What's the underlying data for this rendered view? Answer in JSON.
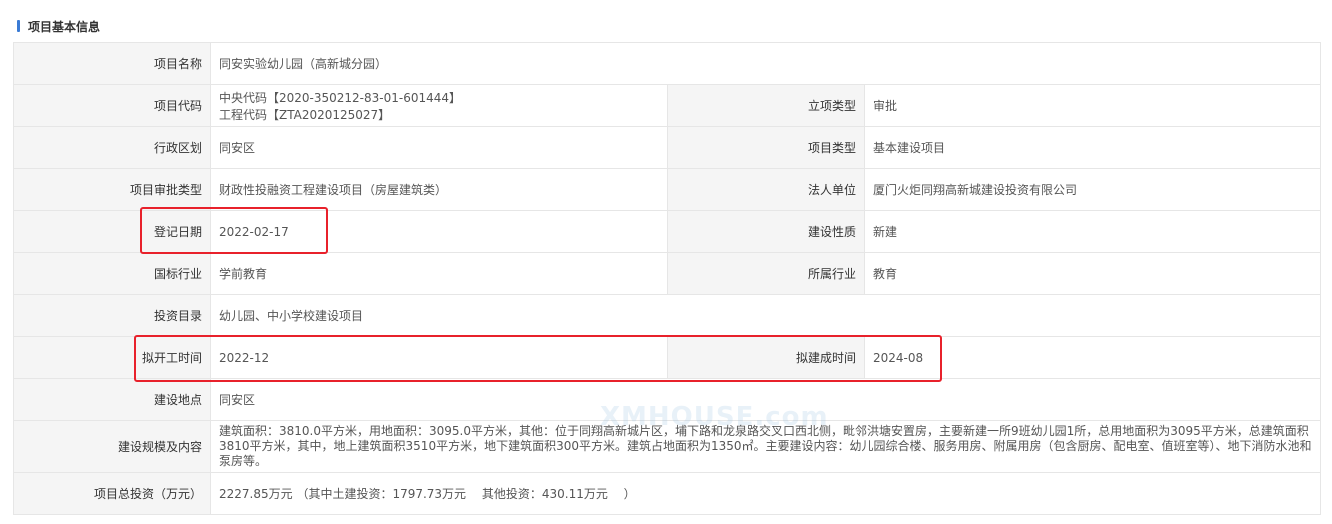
{
  "section": {
    "title": "项目基本信息"
  },
  "watermark": "XMHOUSE.com",
  "fields": {
    "project_name": {
      "label": "项目名称",
      "value": "同安实验幼儿园（高新城分园）"
    },
    "project_code": {
      "label": "项目代码",
      "value_line1": "中央代码【2020-350212-83-01-601444】",
      "value_line2": "工程代码【ZTA2020125027】"
    },
    "approval_type": {
      "label": "立项类型",
      "value": "审批"
    },
    "district": {
      "label": "行政区划",
      "value": "同安区"
    },
    "project_type": {
      "label": "项目类型",
      "value": "基本建设项目"
    },
    "approval_category": {
      "label": "项目审批类型",
      "value": "财政性投融资工程建设项目（房屋建筑类）"
    },
    "legal_entity": {
      "label": "法人单位",
      "value": "厦门火炬同翔高新城建设投资有限公司"
    },
    "registration_date": {
      "label": "登记日期",
      "value": "2022-02-17"
    },
    "construction_nature": {
      "label": "建设性质",
      "value": "新建"
    },
    "national_industry": {
      "label": "国标行业",
      "value": "学前教育"
    },
    "industry": {
      "label": "所属行业",
      "value": "教育"
    },
    "investment_catalog": {
      "label": "投资目录",
      "value": "幼儿园、中小学校建设项目"
    },
    "planned_start": {
      "label": "拟开工时间",
      "value": "2022-12"
    },
    "planned_completion": {
      "label": "拟建成时间",
      "value": "2024-08"
    },
    "location": {
      "label": "建设地点",
      "value": "同安区"
    },
    "scale": {
      "label": "建设规模及内容",
      "line1": "建筑面积：3810.0平方米，用地面积：3095.0平方米，其他：位于同翔高新城片区，埔下路和龙泉路交叉口西北侧，毗邻洪塘安置房，主要新建一所9班幼儿园1所，总用地面积为3095平方米，总建筑面积",
      "line2": "3810平方米，其中，地上建筑面积3510平方米，地下建筑面积300平方米。建筑占地面积为1350㎡。主要建设内容：幼儿园综合楼、服务用房、附属用房（包含厨房、配电室、值班室等）、地下消防水池和",
      "line3": "泵房等。"
    },
    "total_investment": {
      "label": "项目总投资（万元）",
      "value": "2227.85万元 （其中土建投资：1797.73万元　 其他投资：430.11万元　 ）"
    }
  },
  "colors": {
    "accent": "#3a7bd5",
    "highlight": "#e8212b",
    "label_bg": "#f5f5f5",
    "border": "#e6e6e6"
  }
}
